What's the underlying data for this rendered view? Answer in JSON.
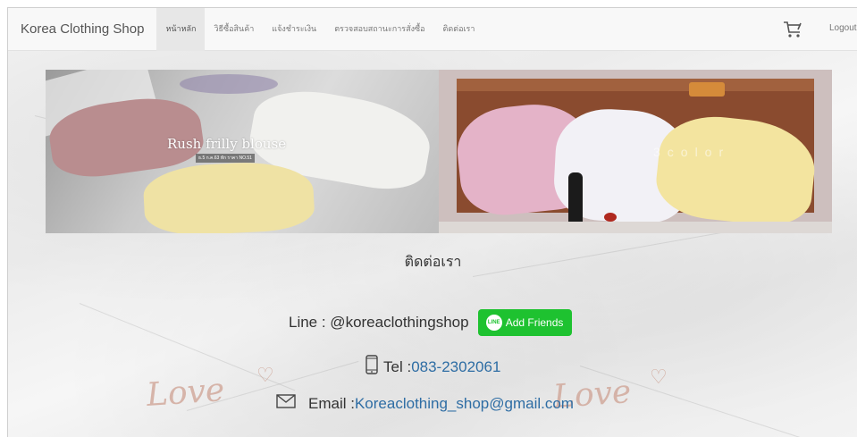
{
  "navbar": {
    "brand": "Korea Clothing Shop",
    "items": [
      {
        "label": "หน้าหลัก",
        "active": true
      },
      {
        "label": "วิธีซื้อสินค้า",
        "active": false
      },
      {
        "label": "แจ้งชำระเงิน",
        "active": false
      },
      {
        "label": "ตรวจสอบสถานะการสั่งซื้อ",
        "active": false
      },
      {
        "label": "ติดต่อเรา",
        "active": false
      }
    ],
    "cart_icon": "shopping-cart-icon",
    "logout_label": "Logout"
  },
  "banner": {
    "caption": "Rush frilly blouse",
    "subcaption": "ธ.5 ก.ค.63 ทัก ราคา NO.51",
    "color_tag": "3color"
  },
  "contact": {
    "title": "ติดต่อเรา",
    "line_label": "Line : @koreaclothingshop",
    "add_friends_label": "Add Friends",
    "line_logo_text": "LINE",
    "tel_label": "Tel :",
    "tel_value": "083-2302061",
    "email_label": "Email :",
    "email_value": "Koreaclothing_shop@gmail.com",
    "decor_text": "Love"
  },
  "colors": {
    "line_green": "#1ec230",
    "link_blue": "#2e6da4",
    "decor_rose": "#cda091"
  }
}
